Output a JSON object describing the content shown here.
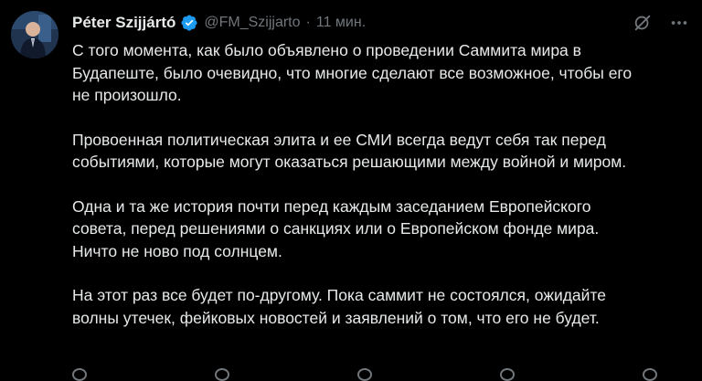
{
  "author": {
    "name": "Péter Szijjártó",
    "handle": "@FM_Szijjarto",
    "separator": "·",
    "time": "11 мин."
  },
  "icons": {
    "avatar": "avatar-photo",
    "verified": "verified-badge-icon",
    "grok": "grok-icon",
    "more": "more-options-icon"
  },
  "colors": {
    "background": "#000000",
    "text": "#e7e9ea",
    "secondary": "#71767b",
    "verified": "#1d9bf0"
  },
  "paragraphs": [
    "С того момента, как было объявлено о проведении Саммита мира в\nБудапеште, было очевидно, что многие сделают все возможное, чтобы его\nне произошло.",
    "Провоенная политическая элита и ее СМИ всегда ведут себя так перед\nсобытиями, которые могут оказаться решающими между войной и миром.",
    "Одна и та же история почти перед каждым заседанием Европейского\nсовета, перед решениями о санкциях или о Европейском фонде мира.\nНичто не ново под солнцем.",
    "На этот раз все будет по-другому. Пока саммит не состоялся, ожидайте\nволны утечек, фейковых новостей и заявлений о том, что его не будет."
  ]
}
